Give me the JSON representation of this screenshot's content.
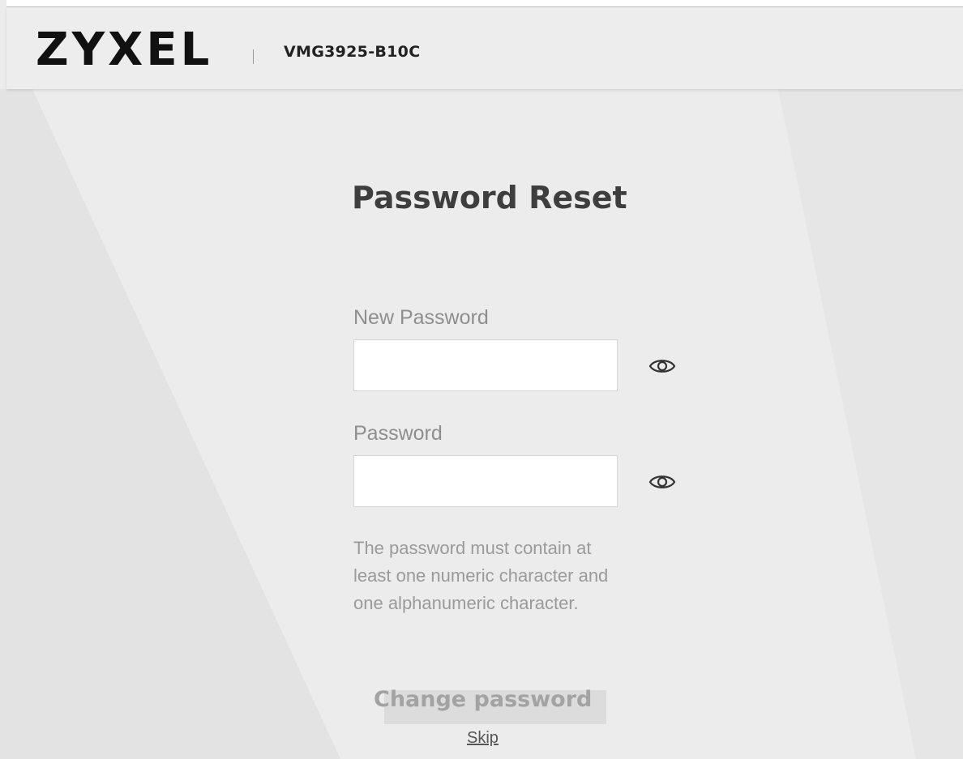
{
  "header": {
    "logo_text": "ZYXEL",
    "model": "VMG3925-B10C"
  },
  "page": {
    "title": "Password Reset"
  },
  "form": {
    "new_password_label": "New Password",
    "new_password_value": "",
    "password_label": "Password",
    "password_value": "",
    "show_password_icon": "eye-icon",
    "hint": "The password must contain at least one numeric character and one alphanumeric character.",
    "change_button": "Change password",
    "skip_link": "Skip"
  },
  "colors": {
    "background": "#ececec",
    "header_background": "#ededed",
    "title": "#3e3e3e",
    "label": "#8e8e8e",
    "hint": "#9a9a9a",
    "button_disabled_bg": "#dcdcdc",
    "button_disabled_text": "#a3a3a3"
  }
}
